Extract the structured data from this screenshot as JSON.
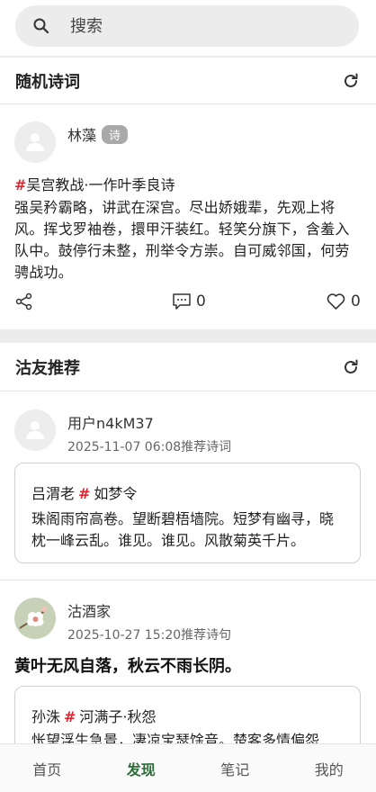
{
  "search": {
    "placeholder": "搜索"
  },
  "random_poetry": {
    "title": "随机诗词",
    "author": "林藻",
    "badge": "诗",
    "hash": "#",
    "poem_title": "吴宫教战·一作叶季良诗",
    "body": "强吴矜霸略，讲武在深宫。尽出娇娥辈，先观上将风。挥戈罗袖卷，擐甲汗装红。轻笑分旗下，含羞入队中。鼓停行未整，刑举令方崇。自可威邻国，何劳骋战功。",
    "comments": "0",
    "likes": "0"
  },
  "friends": {
    "title": "沽友推荐",
    "posts": [
      {
        "username": "用户n4kM37",
        "time": "2025-11-07 06:08推荐诗词",
        "quote_author": "吕渭老",
        "hash": "#",
        "quote_title": "如梦令",
        "quote_body": "珠阁雨帘高卷。望断碧梧墙院。短梦有幽寻，晓枕一峰云乱。谁见。谁见。风散菊英千片。"
      },
      {
        "username": "沽酒家",
        "time": "2025-10-27 15:20推荐诗句",
        "headline": "黄叶无风自落，秋云不雨长阴。",
        "quote_author": "孙洙",
        "hash": "#",
        "quote_title": "河满子·秋怨",
        "quote_body": "怅望浮生急景，凄凉宝瑟馀音。楚客多情偏怨"
      }
    ]
  },
  "tabs": [
    {
      "label": "首页"
    },
    {
      "label": "发现"
    },
    {
      "label": "笔记"
    },
    {
      "label": "我的"
    }
  ],
  "colors": {
    "accent": "#2e6b3a",
    "hash": "#e0262c",
    "badge": "#a9a9a9"
  }
}
